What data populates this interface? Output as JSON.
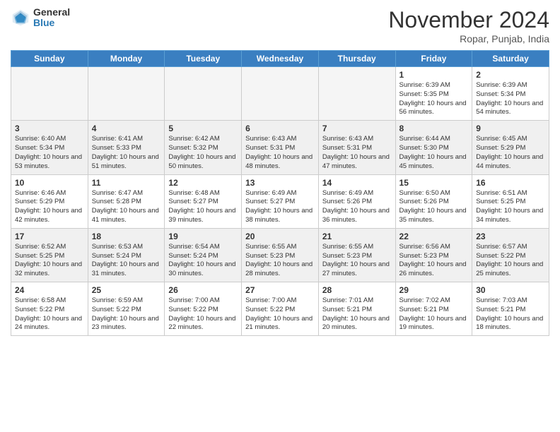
{
  "header": {
    "logo_general": "General",
    "logo_blue": "Blue",
    "month_title": "November 2024",
    "location": "Ropar, Punjab, India"
  },
  "weekdays": [
    "Sunday",
    "Monday",
    "Tuesday",
    "Wednesday",
    "Thursday",
    "Friday",
    "Saturday"
  ],
  "weeks": [
    [
      {
        "day": "",
        "empty": true
      },
      {
        "day": "",
        "empty": true
      },
      {
        "day": "",
        "empty": true
      },
      {
        "day": "",
        "empty": true
      },
      {
        "day": "",
        "empty": true
      },
      {
        "day": "1",
        "sunrise": "Sunrise: 6:39 AM",
        "sunset": "Sunset: 5:35 PM",
        "daylight": "Daylight: 10 hours and 56 minutes."
      },
      {
        "day": "2",
        "sunrise": "Sunrise: 6:39 AM",
        "sunset": "Sunset: 5:34 PM",
        "daylight": "Daylight: 10 hours and 54 minutes."
      }
    ],
    [
      {
        "day": "3",
        "sunrise": "Sunrise: 6:40 AM",
        "sunset": "Sunset: 5:34 PM",
        "daylight": "Daylight: 10 hours and 53 minutes."
      },
      {
        "day": "4",
        "sunrise": "Sunrise: 6:41 AM",
        "sunset": "Sunset: 5:33 PM",
        "daylight": "Daylight: 10 hours and 51 minutes."
      },
      {
        "day": "5",
        "sunrise": "Sunrise: 6:42 AM",
        "sunset": "Sunset: 5:32 PM",
        "daylight": "Daylight: 10 hours and 50 minutes."
      },
      {
        "day": "6",
        "sunrise": "Sunrise: 6:43 AM",
        "sunset": "Sunset: 5:31 PM",
        "daylight": "Daylight: 10 hours and 48 minutes."
      },
      {
        "day": "7",
        "sunrise": "Sunrise: 6:43 AM",
        "sunset": "Sunset: 5:31 PM",
        "daylight": "Daylight: 10 hours and 47 minutes."
      },
      {
        "day": "8",
        "sunrise": "Sunrise: 6:44 AM",
        "sunset": "Sunset: 5:30 PM",
        "daylight": "Daylight: 10 hours and 45 minutes."
      },
      {
        "day": "9",
        "sunrise": "Sunrise: 6:45 AM",
        "sunset": "Sunset: 5:29 PM",
        "daylight": "Daylight: 10 hours and 44 minutes."
      }
    ],
    [
      {
        "day": "10",
        "sunrise": "Sunrise: 6:46 AM",
        "sunset": "Sunset: 5:29 PM",
        "daylight": "Daylight: 10 hours and 42 minutes."
      },
      {
        "day": "11",
        "sunrise": "Sunrise: 6:47 AM",
        "sunset": "Sunset: 5:28 PM",
        "daylight": "Daylight: 10 hours and 41 minutes."
      },
      {
        "day": "12",
        "sunrise": "Sunrise: 6:48 AM",
        "sunset": "Sunset: 5:27 PM",
        "daylight": "Daylight: 10 hours and 39 minutes."
      },
      {
        "day": "13",
        "sunrise": "Sunrise: 6:49 AM",
        "sunset": "Sunset: 5:27 PM",
        "daylight": "Daylight: 10 hours and 38 minutes."
      },
      {
        "day": "14",
        "sunrise": "Sunrise: 6:49 AM",
        "sunset": "Sunset: 5:26 PM",
        "daylight": "Daylight: 10 hours and 36 minutes."
      },
      {
        "day": "15",
        "sunrise": "Sunrise: 6:50 AM",
        "sunset": "Sunset: 5:26 PM",
        "daylight": "Daylight: 10 hours and 35 minutes."
      },
      {
        "day": "16",
        "sunrise": "Sunrise: 6:51 AM",
        "sunset": "Sunset: 5:25 PM",
        "daylight": "Daylight: 10 hours and 34 minutes."
      }
    ],
    [
      {
        "day": "17",
        "sunrise": "Sunrise: 6:52 AM",
        "sunset": "Sunset: 5:25 PM",
        "daylight": "Daylight: 10 hours and 32 minutes."
      },
      {
        "day": "18",
        "sunrise": "Sunrise: 6:53 AM",
        "sunset": "Sunset: 5:24 PM",
        "daylight": "Daylight: 10 hours and 31 minutes."
      },
      {
        "day": "19",
        "sunrise": "Sunrise: 6:54 AM",
        "sunset": "Sunset: 5:24 PM",
        "daylight": "Daylight: 10 hours and 30 minutes."
      },
      {
        "day": "20",
        "sunrise": "Sunrise: 6:55 AM",
        "sunset": "Sunset: 5:23 PM",
        "daylight": "Daylight: 10 hours and 28 minutes."
      },
      {
        "day": "21",
        "sunrise": "Sunrise: 6:55 AM",
        "sunset": "Sunset: 5:23 PM",
        "daylight": "Daylight: 10 hours and 27 minutes."
      },
      {
        "day": "22",
        "sunrise": "Sunrise: 6:56 AM",
        "sunset": "Sunset: 5:23 PM",
        "daylight": "Daylight: 10 hours and 26 minutes."
      },
      {
        "day": "23",
        "sunrise": "Sunrise: 6:57 AM",
        "sunset": "Sunset: 5:22 PM",
        "daylight": "Daylight: 10 hours and 25 minutes."
      }
    ],
    [
      {
        "day": "24",
        "sunrise": "Sunrise: 6:58 AM",
        "sunset": "Sunset: 5:22 PM",
        "daylight": "Daylight: 10 hours and 24 minutes."
      },
      {
        "day": "25",
        "sunrise": "Sunrise: 6:59 AM",
        "sunset": "Sunset: 5:22 PM",
        "daylight": "Daylight: 10 hours and 23 minutes."
      },
      {
        "day": "26",
        "sunrise": "Sunrise: 7:00 AM",
        "sunset": "Sunset: 5:22 PM",
        "daylight": "Daylight: 10 hours and 22 minutes."
      },
      {
        "day": "27",
        "sunrise": "Sunrise: 7:00 AM",
        "sunset": "Sunset: 5:22 PM",
        "daylight": "Daylight: 10 hours and 21 minutes."
      },
      {
        "day": "28",
        "sunrise": "Sunrise: 7:01 AM",
        "sunset": "Sunset: 5:21 PM",
        "daylight": "Daylight: 10 hours and 20 minutes."
      },
      {
        "day": "29",
        "sunrise": "Sunrise: 7:02 AM",
        "sunset": "Sunset: 5:21 PM",
        "daylight": "Daylight: 10 hours and 19 minutes."
      },
      {
        "day": "30",
        "sunrise": "Sunrise: 7:03 AM",
        "sunset": "Sunset: 5:21 PM",
        "daylight": "Daylight: 10 hours and 18 minutes."
      }
    ]
  ]
}
